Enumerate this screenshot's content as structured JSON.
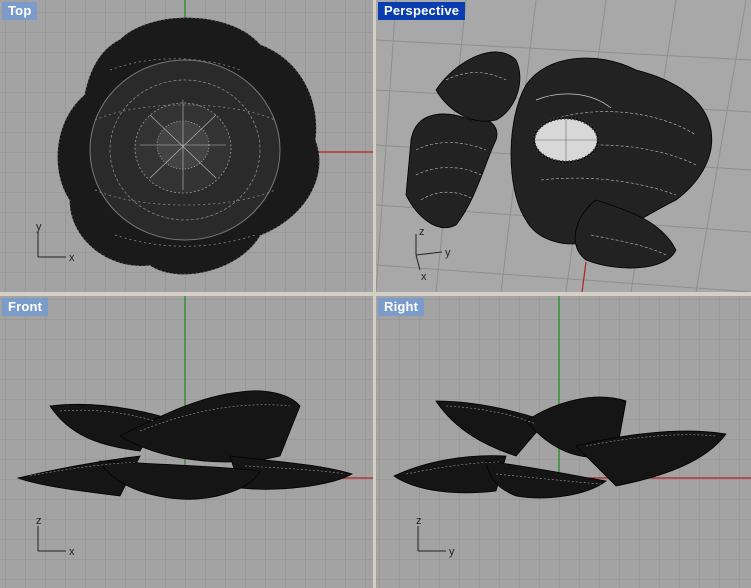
{
  "viewports": [
    {
      "id": "top",
      "title": "Top",
      "axes": {
        "vertical": "y",
        "horizontal": "x"
      }
    },
    {
      "id": "perspective",
      "title": "Perspective",
      "axes": {
        "vertical": "z",
        "horizontal": "y",
        "depth": "x"
      }
    },
    {
      "id": "front",
      "title": "Front",
      "axes": {
        "vertical": "z",
        "horizontal": "x"
      }
    },
    {
      "id": "right",
      "title": "Right",
      "axes": {
        "vertical": "z",
        "horizontal": "y"
      }
    }
  ],
  "active_viewport": "Perspective",
  "colors": {
    "viewport_bg": "#a3a3a3",
    "grid": "#8f8f8f",
    "grid_major": "#7a7a7a",
    "x_axis": "#b22222",
    "y_axis": "#1a8a1a",
    "mesh": "#000000",
    "title_active": "#0a3eb0",
    "title_inactive": "#7b9bc9"
  }
}
